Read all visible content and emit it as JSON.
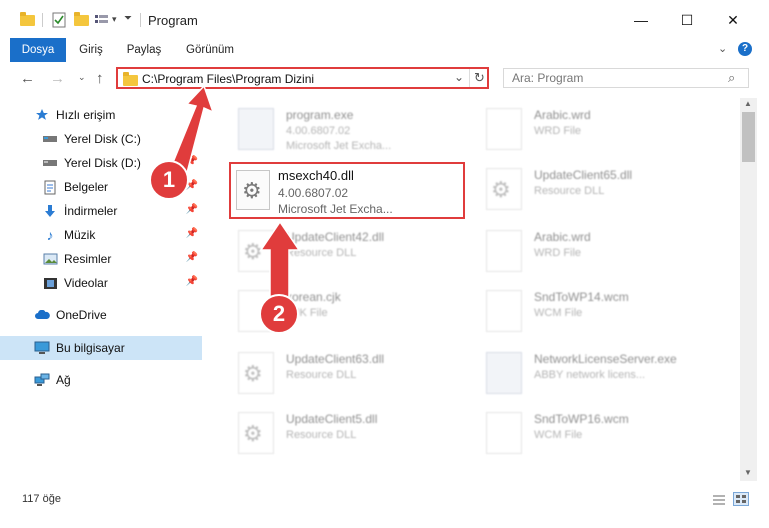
{
  "window": {
    "title": "Program",
    "controls": [
      "—",
      "☐",
      "✕"
    ]
  },
  "ribbon": {
    "tabs": [
      "Dosya",
      "Giriş",
      "Paylaş",
      "Görünüm"
    ]
  },
  "navigation": {
    "address": "C:\\Program Files\\Program Dizini",
    "search_placeholder": "Ara: Program"
  },
  "sidebar": {
    "items": [
      {
        "label": "Hızlı erişim",
        "icon": "star-icon"
      },
      {
        "label": "Yerel Disk (C:)",
        "icon": "drive-icon"
      },
      {
        "label": "Yerel Disk (D:)",
        "icon": "drive-icon"
      },
      {
        "label": "Belgeler",
        "icon": "documents-icon"
      },
      {
        "label": "İndirmeler",
        "icon": "download-icon"
      },
      {
        "label": "Müzik",
        "icon": "music-icon"
      },
      {
        "label": "Resimler",
        "icon": "pictures-icon"
      },
      {
        "label": "Videolar",
        "icon": "video-icon"
      },
      {
        "label": "OneDrive",
        "icon": "cloud-icon"
      },
      {
        "label": "Bu bilgisayar",
        "icon": "computer-icon"
      },
      {
        "label": "Ağ",
        "icon": "network-icon"
      }
    ]
  },
  "files": [
    {
      "name": "program.exe",
      "line2": "4.00.6807.02",
      "line3": "Microsoft Jet Excha...",
      "kind": "exe"
    },
    {
      "name": "Arabic.wrd",
      "line2": "WRD File",
      "line3": "",
      "kind": "doc"
    },
    {
      "name": "UpdateClient65.dll",
      "line2": "Resource DLL",
      "line3": "",
      "kind": "gear"
    },
    {
      "name": "UpdateClient42.dll",
      "line2": "Resource DLL",
      "line3": "",
      "kind": "gear"
    },
    {
      "name": "Arabic.wrd",
      "line2": "WRD File",
      "line3": "",
      "kind": "doc"
    },
    {
      "name": "korean.cjk",
      "line2": "CJK File",
      "line3": "",
      "kind": "doc"
    },
    {
      "name": "SndToWP14.wcm",
      "line2": "WCM File",
      "line3": "",
      "kind": "doc"
    },
    {
      "name": "UpdateClient63.dll",
      "line2": "Resource DLL",
      "line3": "",
      "kind": "gear"
    },
    {
      "name": "NetworkLicenseServer.exe",
      "line2": "ABBY network licens...",
      "line3": "",
      "kind": "exe"
    },
    {
      "name": "UpdateClient5.dll",
      "line2": "Resource DLL",
      "line3": "",
      "kind": "gear"
    },
    {
      "name": "SndToWP16.wcm",
      "line2": "WCM File",
      "line3": "",
      "kind": "doc"
    }
  ],
  "highlighted_file": {
    "name": "msexch40.dll",
    "version": "4.00.6807.02",
    "description": "Microsoft Jet Excha..."
  },
  "status": {
    "item_count": "117 öğe"
  },
  "annotations": {
    "step1": "1",
    "step2": "2",
    "color": "#e03c3c"
  }
}
